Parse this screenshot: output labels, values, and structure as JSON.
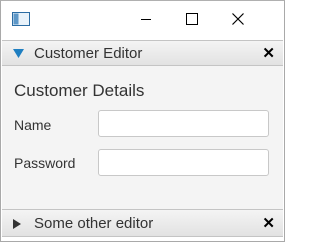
{
  "window": {
    "title": "",
    "controls": {
      "minimize": "minimize",
      "maximize": "maximize",
      "close": "close"
    }
  },
  "panes": [
    {
      "title": "Customer Editor",
      "expanded": true,
      "close_glyph": "✕"
    },
    {
      "title": "Some other editor",
      "expanded": false,
      "close_glyph": "✕"
    }
  ],
  "customer_details": {
    "heading": "Customer Details",
    "fields": [
      {
        "label": "Name",
        "value": ""
      },
      {
        "label": "Password",
        "value": ""
      }
    ]
  },
  "colors": {
    "accent": "#1f7fc1",
    "header_bg": "#e8e8e8",
    "content_bg": "#f4f4f4"
  }
}
